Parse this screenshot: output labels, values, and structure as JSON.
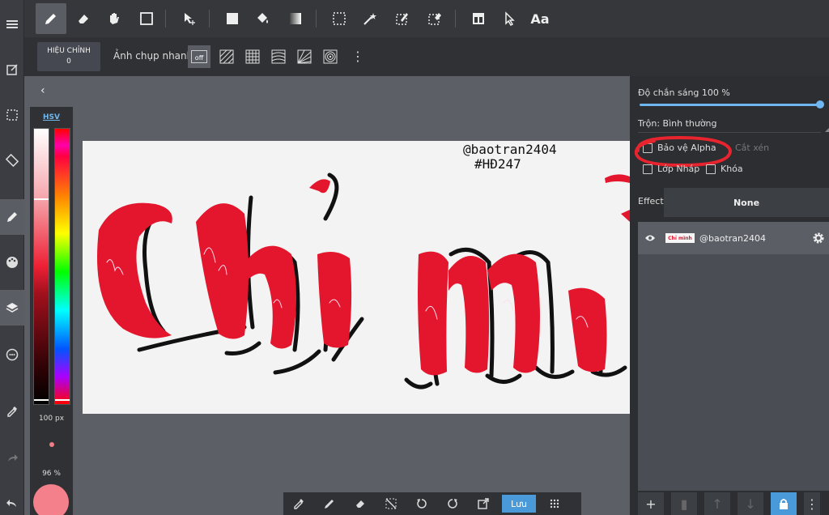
{
  "toolbar": {
    "text_tool_label": "Aa"
  },
  "subtoolbar": {
    "correction_label": "HIỆU CHỈNH",
    "correction_value": "0",
    "snap_label": "Ảnh chụp nhanh",
    "snap_off": "off"
  },
  "color_panel": {
    "mode": "HSV",
    "brush_size": "100 px",
    "opacity": "96 %",
    "current_color": "#f3808a"
  },
  "canvas": {
    "handle_line1": "@baotran2404",
    "handle_line2": "#HĐ247"
  },
  "layer_panel": {
    "opacity_label": "Độ chắn sáng  100  %",
    "blend_label": "Trộn: Bình thường",
    "protect_alpha": "Bảo vệ Alpha",
    "clipping": "Cắt xén",
    "draft_layer": "Lớp Nháp",
    "lock": "Khóa",
    "effect_label": "Effect",
    "effect_value": "None",
    "layer_name": "@baotran2404",
    "layer_thumb_text": "Chỉ mình"
  },
  "bottombar": {
    "save_label": "Lưu"
  },
  "colors": {
    "accent": "#4a9ad9",
    "annotation_red": "#e8242e",
    "ink_red": "#e0172e"
  }
}
